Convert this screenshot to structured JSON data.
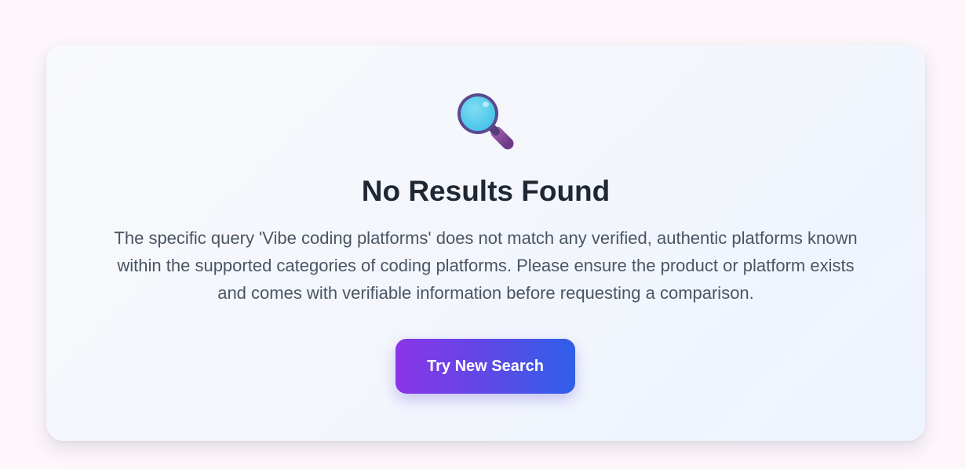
{
  "empty_state": {
    "icon": "magnifying-glass-icon",
    "title": "No Results Found",
    "message": "The specific query 'Vibe coding platforms' does not match any verified, authentic platforms known within the supported categories of coding platforms. Please ensure the product or platform exists and comes with verifiable information before requesting a comparison.",
    "button_label": "Try New Search"
  },
  "colors": {
    "button_gradient_start": "#8a35e8",
    "button_gradient_end": "#2f5fe8",
    "title": "#1f2733",
    "message": "#4a5563",
    "card_background": "#f3f6fc"
  }
}
